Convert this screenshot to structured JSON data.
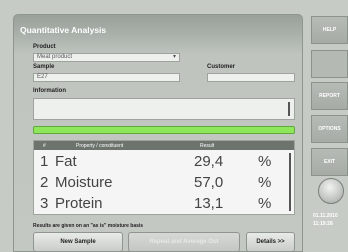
{
  "panel": {
    "title": "Quantitative Analysis"
  },
  "form": {
    "product_label": "Product",
    "product_value": "Meat product",
    "sample_label": "Sample",
    "sample_value": "E27",
    "customer_label": "Customer",
    "customer_value": "",
    "information_label": "Information",
    "information_value": ""
  },
  "progress": {
    "value": 1.0
  },
  "table": {
    "headers": [
      "#",
      "Property / constituent",
      "Result"
    ],
    "rows": [
      {
        "num": "1",
        "name": "Fat",
        "value": "29,4",
        "unit": "%"
      },
      {
        "num": "2",
        "name": "Moisture",
        "value": "57,0",
        "unit": "%"
      },
      {
        "num": "3",
        "name": "Protein",
        "value": "13,1",
        "unit": "%"
      }
    ]
  },
  "footnote": "Results are given on an \"as is\" moisture basis",
  "buttons": {
    "new_sample": "New Sample",
    "repeat": "Repeat and Average Out",
    "details": "Details >>"
  },
  "sidebar": {
    "help": "HELP",
    "report": "REPORT",
    "options": "OPTIONS",
    "exit": "EXIT",
    "date": "01.11.2010",
    "time": "11:19:28"
  },
  "colors": {
    "progress": "#8ee65a",
    "panel_header": "#9aa19b"
  }
}
